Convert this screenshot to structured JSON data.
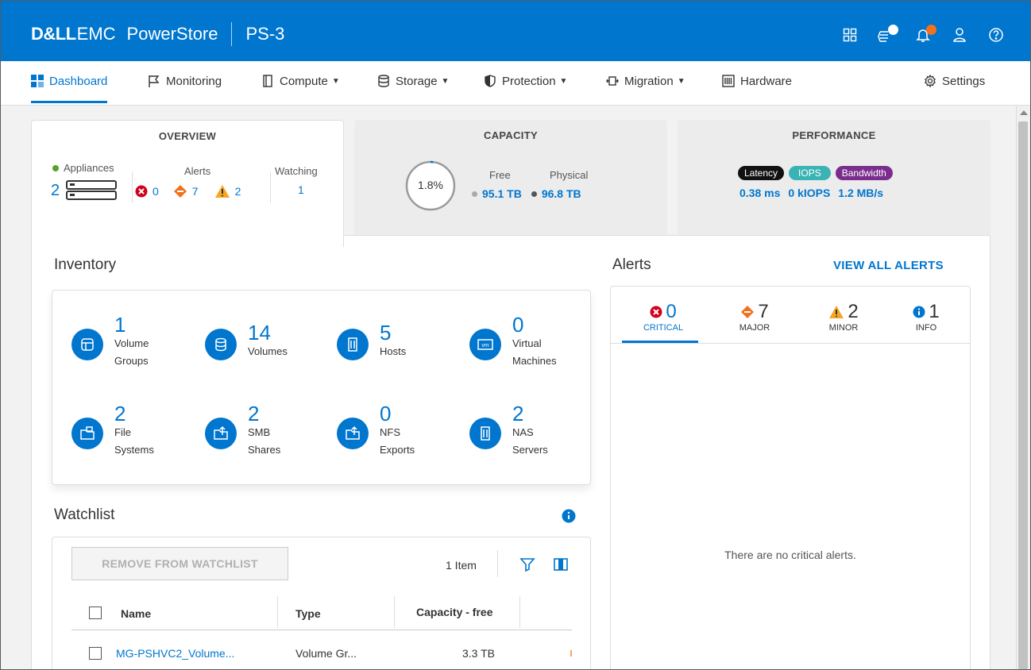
{
  "header": {
    "brand_dell": "D&LL",
    "brand_emc": "EMC",
    "product": "PowerStore",
    "system": "PS-3"
  },
  "nav": {
    "dashboard": "Dashboard",
    "monitoring": "Monitoring",
    "compute": "Compute",
    "storage": "Storage",
    "protection": "Protection",
    "migration": "Migration",
    "hardware": "Hardware",
    "settings": "Settings"
  },
  "overview": {
    "title": "OVERVIEW",
    "appliances_label": "Appliances",
    "appliances_count": "2",
    "alerts_label": "Alerts",
    "critical": "0",
    "major": "7",
    "minor": "2",
    "watching_label": "Watching",
    "watching": "1"
  },
  "capacity": {
    "title": "CAPACITY",
    "percent": "1.8%",
    "used_fraction": 0.018,
    "free_label": "Free",
    "physical_label": "Physical",
    "free": "95.1 TB",
    "physical": "96.8 TB"
  },
  "performance": {
    "title": "PERFORMANCE",
    "latency_label": "Latency",
    "iops_label": "IOPS",
    "bandwidth_label": "Bandwidth",
    "latency": "0.38 ms",
    "iops": "0 kIOPS",
    "bandwidth": "1.2 MB/s"
  },
  "inventory": {
    "title": "Inventory",
    "items": [
      {
        "count": "1",
        "label": "Volume\nGroups"
      },
      {
        "count": "14",
        "label": "Volumes"
      },
      {
        "count": "5",
        "label": "Hosts"
      },
      {
        "count": "0",
        "label": "Virtual\nMachines"
      },
      {
        "count": "2",
        "label": "File\nSystems"
      },
      {
        "count": "2",
        "label": "SMB\nShares"
      },
      {
        "count": "0",
        "label": "NFS\nExports"
      },
      {
        "count": "2",
        "label": "NAS\nServers"
      }
    ]
  },
  "alerts": {
    "title": "Alerts",
    "view_all": "VIEW ALL ALERTS",
    "tabs": [
      {
        "count": "0",
        "label": "CRITICAL"
      },
      {
        "count": "7",
        "label": "MAJOR"
      },
      {
        "count": "2",
        "label": "MINOR"
      },
      {
        "count": "1",
        "label": "INFO"
      }
    ],
    "empty_message": "There are no critical alerts."
  },
  "watchlist": {
    "title": "Watchlist",
    "remove_button": "REMOVE FROM WATCHLIST",
    "item_count": "1 Item",
    "columns": [
      "Name",
      "Type",
      "Capacity - free"
    ],
    "rows": [
      {
        "name": "MG-PSHVC2_Volume...",
        "type": "Volume Gr...",
        "capacity": "3.3 TB"
      }
    ]
  },
  "colors": {
    "brand_blue": "#0076ce",
    "critical": "#d0021b",
    "major": "#f2711c",
    "minor": "#f5a623",
    "latency_pill": "#111111",
    "iops_pill": "#3ab3b5",
    "bandwidth_pill": "#7b2d8e"
  }
}
